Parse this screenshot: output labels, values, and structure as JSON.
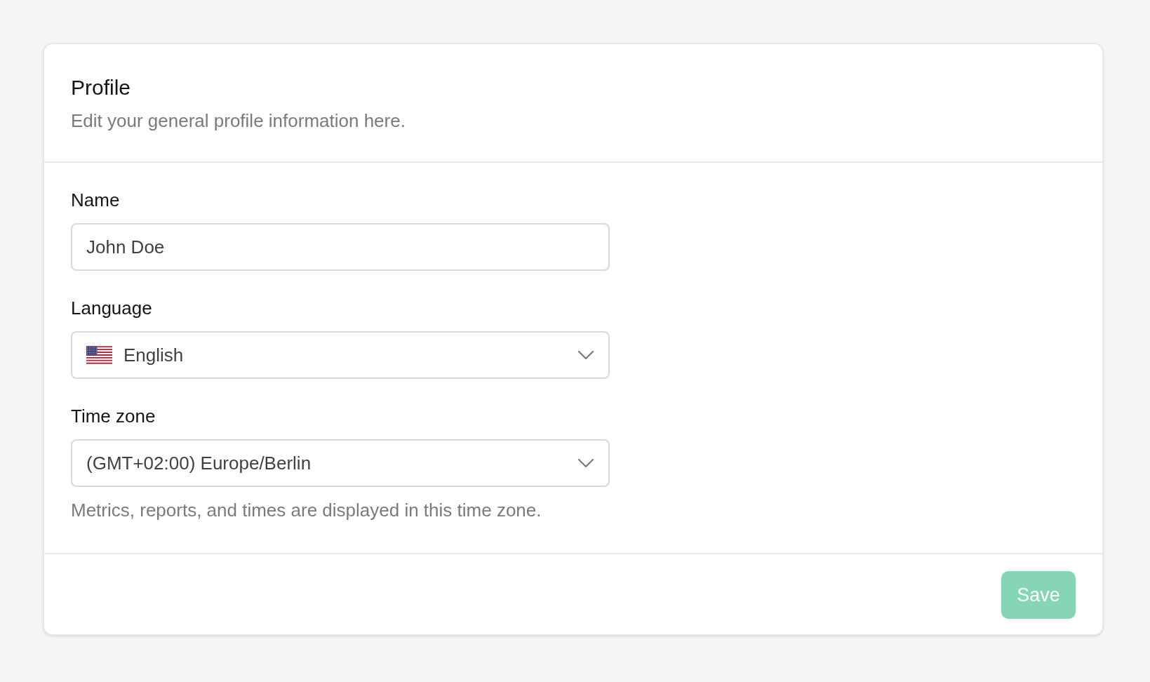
{
  "card": {
    "title": "Profile",
    "subtitle": "Edit your general profile information here."
  },
  "fields": [
    {
      "kind": "text",
      "label": "Name",
      "value": "John Doe"
    },
    {
      "kind": "language",
      "label": "Language",
      "value": "English"
    },
    {
      "kind": "select",
      "label": "Time zone",
      "value": "(GMT+02:00) Europe/Berlin",
      "help": "Metrics, reports, and times are displayed in this time zone."
    }
  ],
  "footer": {
    "save_button": {
      "label": "Save",
      "disabled": true
    }
  }
}
